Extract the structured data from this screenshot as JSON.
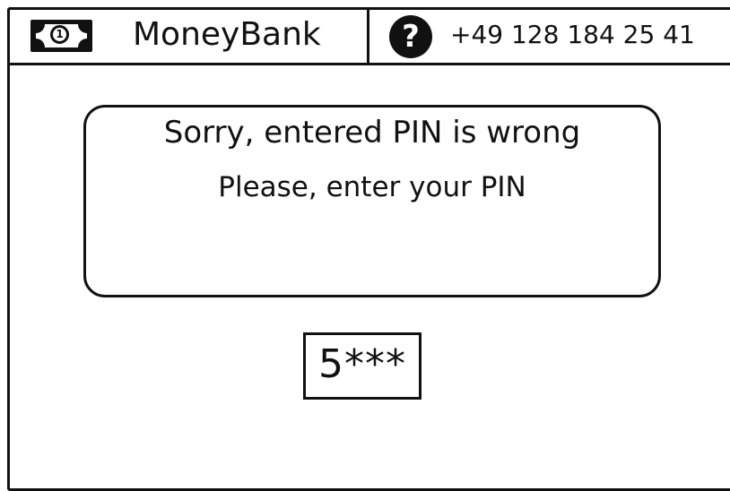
{
  "header": {
    "brand": "MoneyBank",
    "money_icon_glyph": "1",
    "help_icon_glyph": "?",
    "phone": "+49 128 184 25 41"
  },
  "message": {
    "line1": "Sorry, entered PIN is wrong",
    "line2": "Please, enter your PIN"
  },
  "pin": {
    "value": "5***"
  },
  "icons": {
    "money": "money-bill-icon",
    "help": "help-icon"
  }
}
